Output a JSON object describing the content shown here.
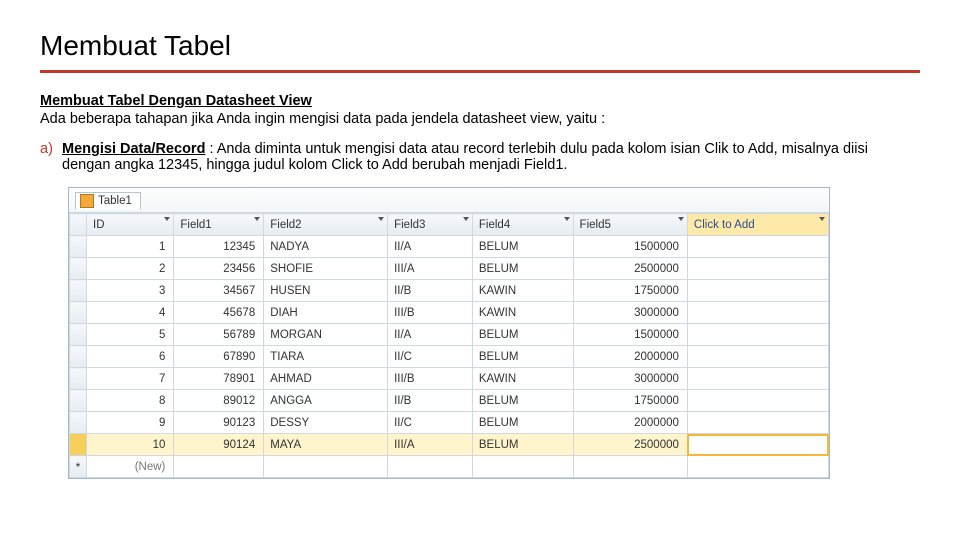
{
  "title": "Membuat Tabel",
  "subtitle": "Membuat Tabel Dengan Datasheet View",
  "intro": "Ada beberapa tahapan jika Anda ingin mengisi data pada jendela datasheet view, yaitu :",
  "step": {
    "marker": "a)",
    "label": "Mengisi Data/Record",
    "text_after_label": " : Anda diminta untuk mengisi data atau record terlebih dulu pada kolom isian Clik to Add, misalnya diisi dengan angka 12345, hingga judul kolom Click to Add berubah menjadi Field1."
  },
  "datasheet": {
    "tab_name": "Table1",
    "columns": [
      "ID",
      "Field1",
      "Field2",
      "Field3",
      "Field4",
      "Field5"
    ],
    "click_to_add": "Click to Add",
    "new_row_label": "(New)",
    "selected_row_index": 9,
    "rows": [
      {
        "id": "1",
        "f1": "12345",
        "f2": "NADYA",
        "f3": "II/A",
        "f4": "BELUM",
        "f5": "1500000"
      },
      {
        "id": "2",
        "f1": "23456",
        "f2": "SHOFIE",
        "f3": "III/A",
        "f4": "BELUM",
        "f5": "2500000"
      },
      {
        "id": "3",
        "f1": "34567",
        "f2": "HUSEN",
        "f3": "II/B",
        "f4": "KAWIN",
        "f5": "1750000"
      },
      {
        "id": "4",
        "f1": "45678",
        "f2": "DIAH",
        "f3": "III/B",
        "f4": "KAWIN",
        "f5": "3000000"
      },
      {
        "id": "5",
        "f1": "56789",
        "f2": "MORGAN",
        "f3": "II/A",
        "f4": "BELUM",
        "f5": "1500000"
      },
      {
        "id": "6",
        "f1": "67890",
        "f2": "TIARA",
        "f3": "II/C",
        "f4": "BELUM",
        "f5": "2000000"
      },
      {
        "id": "7",
        "f1": "78901",
        "f2": "AHMAD",
        "f3": "III/B",
        "f4": "KAWIN",
        "f5": "3000000"
      },
      {
        "id": "8",
        "f1": "89012",
        "f2": "ANGGA",
        "f3": "II/B",
        "f4": "BELUM",
        "f5": "1750000"
      },
      {
        "id": "9",
        "f1": "90123",
        "f2": "DESSY",
        "f3": "II/C",
        "f4": "BELUM",
        "f5": "2000000"
      },
      {
        "id": "10",
        "f1": "90124",
        "f2": "MAYA",
        "f3": "III/A",
        "f4": "BELUM",
        "f5": "2500000"
      }
    ]
  }
}
